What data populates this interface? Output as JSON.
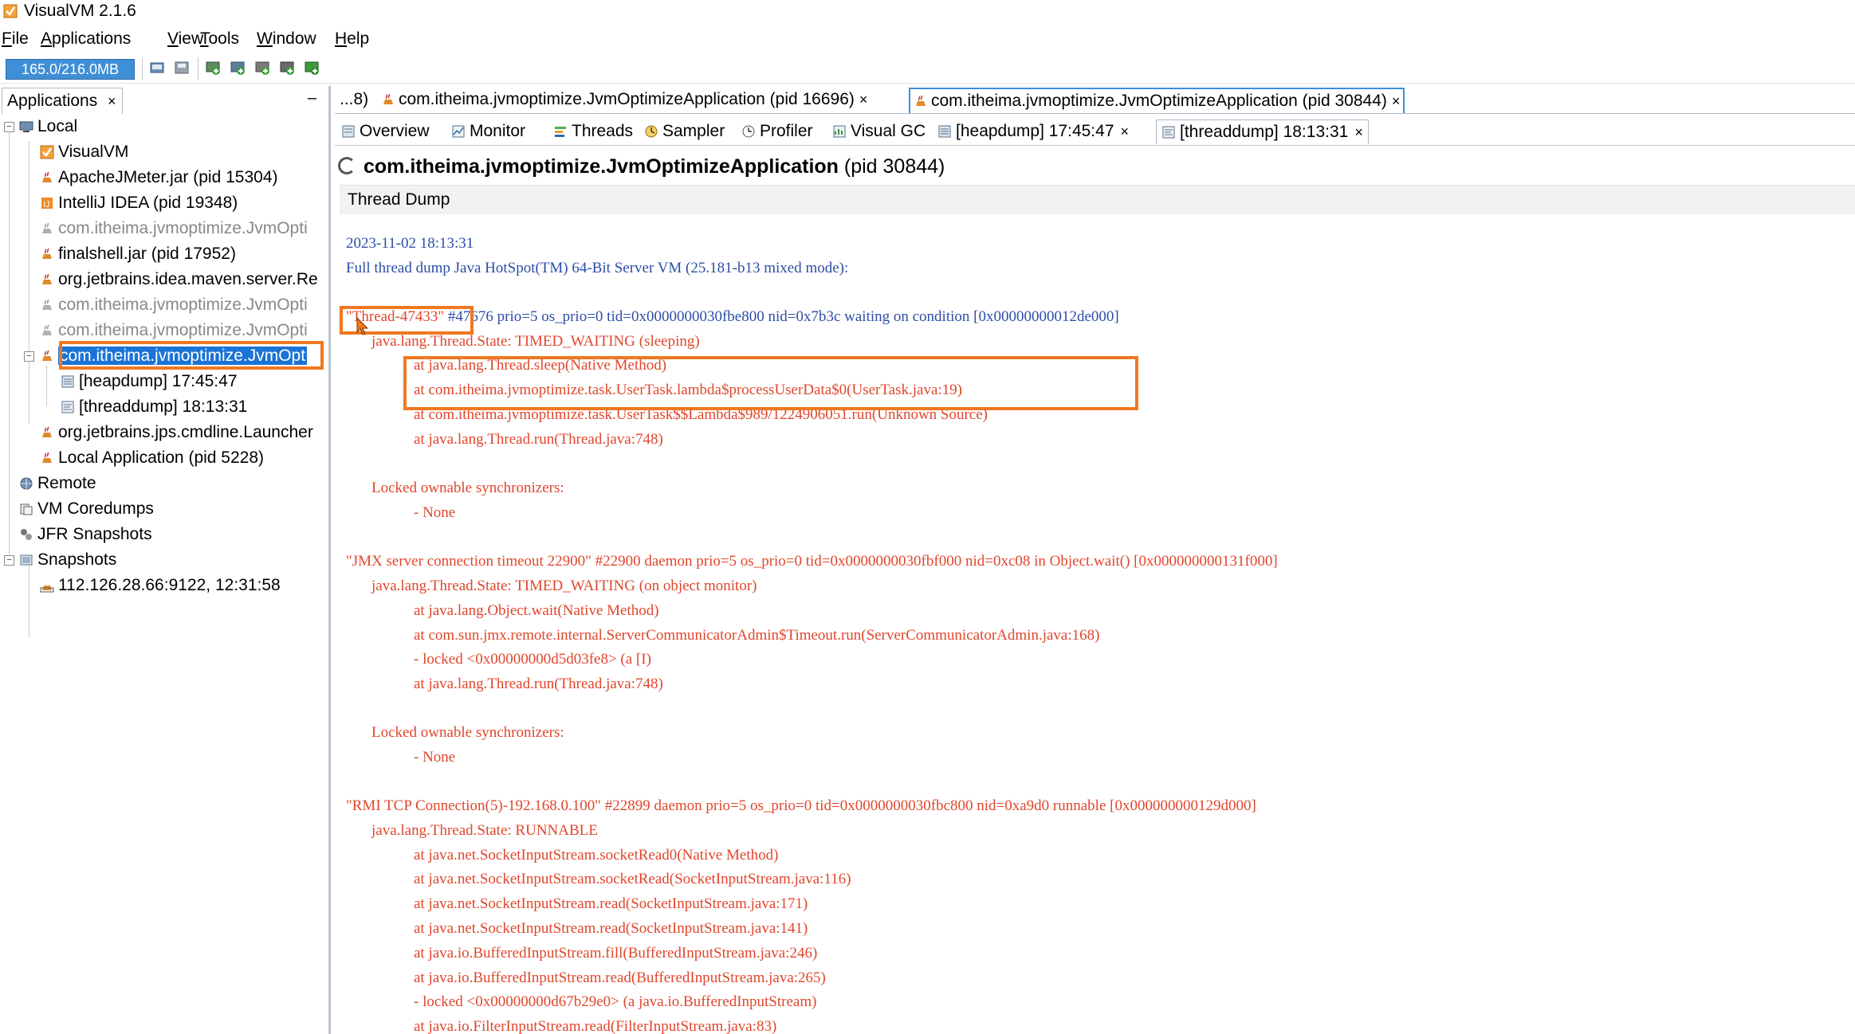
{
  "window": {
    "title": "VisualVM 2.1.6"
  },
  "menu": {
    "items": [
      {
        "mnemonic": "F",
        "rest": "ile"
      },
      {
        "mnemonic": "A",
        "rest": "pplications"
      },
      {
        "mnemonic": "V",
        "rest": "iew"
      },
      {
        "mnemonic": "T",
        "rest": "ools"
      },
      {
        "mnemonic": "W",
        "rest": "indow"
      },
      {
        "mnemonic": "H",
        "rest": "elp"
      }
    ]
  },
  "toolbar": {
    "memory": "165.0/216.0MB"
  },
  "left_panel": {
    "tab_label": "Applications",
    "tab_close": "×",
    "minimize": "–",
    "tree": {
      "local": "Local",
      "visualvm": "VisualVM",
      "jmeter": "ApacheJMeter.jar (pid 15304)",
      "intellij": "IntelliJ IDEA (pid 19348)",
      "app1": "com.itheima.jvmoptimize.JvmOpti",
      "finalshell": "finalshell.jar (pid 17952)",
      "maven": "org.jetbrains.idea.maven.server.Re",
      "app2": "com.itheima.jvmoptimize.JvmOpti",
      "app3": "com.itheima.jvmoptimize.JvmOpti",
      "app_selected": "com.itheima.jvmoptimize.JvmOpt",
      "heapdump": "[heapdump] 17:45:47",
      "threaddump": "[threaddump] 18:13:31",
      "jps": "org.jetbrains.jps.cmdline.Launcher",
      "local_app": "Local Application (pid 5228)",
      "remote": "Remote",
      "coredumps": "VM Coredumps",
      "jfr": "JFR Snapshots",
      "snapshots": "Snapshots",
      "snapshot_item": "112.126.28.66:9122, 12:31:58"
    }
  },
  "editor_tabs": {
    "overflow": "...8)",
    "tab1": "com.itheima.jvmoptimize.JvmOptimizeApplication (pid 16696)",
    "tab2": "com.itheima.jvmoptimize.JvmOptimizeApplication (pid 30844)",
    "close": "×"
  },
  "view_tabs": {
    "overview": "Overview",
    "monitor": "Monitor",
    "threads": "Threads",
    "sampler": "Sampler",
    "profiler": "Profiler",
    "visualgc": "Visual GC",
    "heapdump": "[heapdump] 17:45:47",
    "threaddump": "[threaddump] 18:13:31",
    "close": "×"
  },
  "header": {
    "app_name": "com.itheima.jvmoptimize.JvmOptimizeApplication",
    "pid": " (pid 30844)"
  },
  "section": {
    "title": "Thread Dump"
  },
  "dump": {
    "l01": "2023-11-02 18:13:31",
    "l02": "Full thread dump Java HotSpot(TM) 64-Bit Server VM (25.181-b13 mixed mode):",
    "t1_name": "\"Thread-47433\"",
    "t1_rest": " #47676 prio=5 os_prio=0 tid=0x0000000030fbe800 nid=0x7b3c waiting on condition [0x00000000012de000]",
    "t1_state": "java.lang.Thread.State: TIMED_WAITING (sleeping)",
    "t1_f1": "at java.lang.Thread.sleep(Native Method)",
    "t1_f2": "at com.itheima.jvmoptimize.task.UserTask.lambda$processUserData$0(UserTask.java:19)",
    "t1_f3": "at com.itheima.jvmoptimize.task.UserTask$$Lambda$989/1224906051.run(Unknown Source)",
    "t1_f4": "at java.lang.Thread.run(Thread.java:748)",
    "t1_locked": "Locked ownable synchronizers:",
    "t1_none": "- None",
    "t2_head": "\"JMX server connection timeout 22900\" #22900 daemon prio=5 os_prio=0 tid=0x0000000030fbf000 nid=0xc08 in Object.wait() [0x000000000131f000]",
    "t2_state": "java.lang.Thread.State: TIMED_WAITING (on object monitor)",
    "t2_f1": "at java.lang.Object.wait(Native Method)",
    "t2_f2": "at com.sun.jmx.remote.internal.ServerCommunicatorAdmin$Timeout.run(ServerCommunicatorAdmin.java:168)",
    "t2_f3": "- locked <0x00000000d5d03fe8> (a [I)",
    "t2_f4": "at java.lang.Thread.run(Thread.java:748)",
    "t2_locked": "Locked ownable synchronizers:",
    "t2_none": "- None",
    "t3_head": "\"RMI TCP Connection(5)-192.168.0.100\" #22899 daemon prio=5 os_prio=0 tid=0x0000000030fbc800 nid=0xa9d0 runnable [0x000000000129d000]",
    "t3_state": "java.lang.Thread.State: RUNNABLE",
    "t3_f1": "at java.net.SocketInputStream.socketRead0(Native Method)",
    "t3_f2": "at java.net.SocketInputStream.socketRead(SocketInputStream.java:116)",
    "t3_f3": "at java.net.SocketInputStream.read(SocketInputStream.java:171)",
    "t3_f4": "at java.net.SocketInputStream.read(SocketInputStream.java:141)",
    "t3_f5": "at java.io.BufferedInputStream.fill(BufferedInputStream.java:246)",
    "t3_f6": "at java.io.BufferedInputStream.read(BufferedInputStream.java:265)",
    "t3_f7": "- locked <0x00000000d67b29e0> (a java.io.BufferedInputStream)",
    "t3_f8": "at java.io.FilterInputStream.read(FilterInputStream.java:83)"
  },
  "colors": {
    "accent": "#1a73d6",
    "highlight": "#f07820",
    "dump_blue": "#2d4ea6",
    "dump_red": "#e0462c"
  }
}
